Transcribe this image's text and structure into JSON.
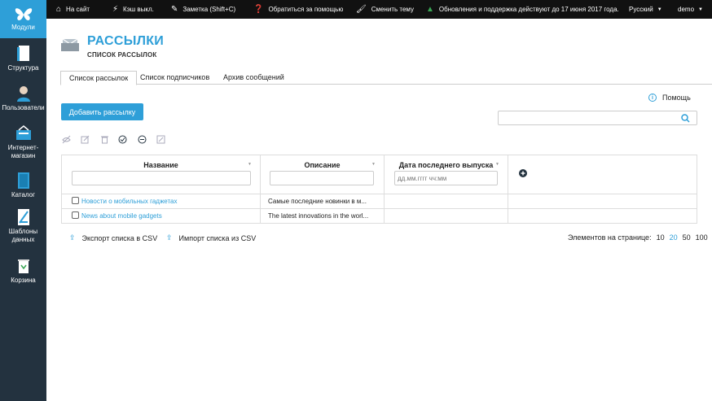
{
  "sidebar": {
    "items": [
      {
        "label": "Модули",
        "icon": "butterfly-icon"
      },
      {
        "label": "Структура",
        "icon": "structure-icon"
      },
      {
        "label": "Пользователи",
        "icon": "users-icon"
      },
      {
        "label": "Интернет-магазин",
        "icon": "cart-icon"
      },
      {
        "label": "Каталог",
        "icon": "catalog-icon"
      },
      {
        "label": "Шаблоны данных",
        "icon": "templates-icon"
      },
      {
        "label": "Корзина",
        "icon": "trash-icon"
      }
    ]
  },
  "topbar": {
    "home": "На сайт",
    "cache": "Кэш выкл.",
    "note": "Заметка (Shift+C)",
    "help": "Обратиться за помощью",
    "theme": "Сменить тему",
    "updates": "Обновления и поддержка действуют до 17 июня 2017 года.",
    "language": "Русский",
    "user": "demo"
  },
  "header": {
    "title": "РАССЫЛКИ",
    "subtitle": "СПИСОК РАССЫЛОК"
  },
  "tabs": [
    {
      "label": "Список рассылок",
      "active": true
    },
    {
      "label": "Список подписчиков",
      "active": false
    },
    {
      "label": "Архив сообщений",
      "active": false
    }
  ],
  "actions": {
    "add_label": "Добавить рассылку",
    "help_label": "Помощь",
    "search_placeholder": ""
  },
  "table": {
    "columns": [
      {
        "label": "Название",
        "filter": ""
      },
      {
        "label": "Описание",
        "filter": ""
      },
      {
        "label": "Дата последнего выпуска",
        "filter_placeholder": "дд.мм.гггг чч:мм"
      }
    ],
    "rows": [
      {
        "name": "Новости о мобильных гаджетах",
        "description": "Самые последние новинки в м...",
        "date": ""
      },
      {
        "name": "News about mobile gadgets",
        "description": "The latest innovations in the worl...",
        "date": ""
      }
    ]
  },
  "footer": {
    "export": "Экспорт списка в CSV",
    "import": "Импорт списка из CSV",
    "per_page_label": "Элементов на странице:",
    "per_page_options": [
      "10",
      "20",
      "50",
      "100"
    ],
    "per_page_selected": "20"
  },
  "colors": {
    "accent": "#2e9fd8",
    "sidebar": "#23323f",
    "topbar": "#111111"
  }
}
